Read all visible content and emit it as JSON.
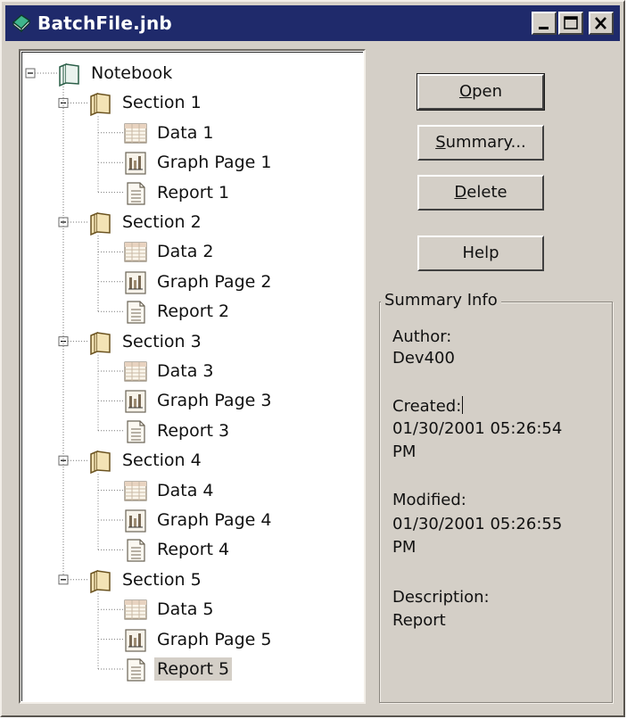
{
  "window": {
    "title": "BatchFile.jnb"
  },
  "tree": {
    "root": {
      "label": "Notebook"
    },
    "sections": [
      {
        "label": "Section 1",
        "data": "Data 1",
        "graph": "Graph Page 1",
        "report": "Report 1"
      },
      {
        "label": "Section 2",
        "data": "Data 2",
        "graph": "Graph Page 2",
        "report": "Report 2"
      },
      {
        "label": "Section 3",
        "data": "Data 3",
        "graph": "Graph Page 3",
        "report": "Report 3"
      },
      {
        "label": "Section 4",
        "data": "Data 4",
        "graph": "Graph Page 4",
        "report": "Report 4"
      },
      {
        "label": "Section 5",
        "data": "Data 5",
        "graph": "Graph Page 5",
        "report": "Report 5"
      }
    ],
    "selected": "Report 5"
  },
  "buttons": {
    "open": {
      "mn": "O",
      "rest": "pen"
    },
    "summary": {
      "mn": "S",
      "rest": "ummary..."
    },
    "delete": {
      "mn": "D",
      "rest": "elete"
    },
    "help": {
      "label": "Help"
    }
  },
  "summary": {
    "legend": "Summary Info",
    "author_label": "Author:",
    "author": "Dev400",
    "created_label": "Created:",
    "created_line1": "01/30/2001 05:26:54",
    "created_line2": "PM",
    "modified_label": "Modified:",
    "modified_line1": "01/30/2001 05:26:55",
    "modified_line2": "PM",
    "description_label": "Description:",
    "description": "Report"
  },
  "colors": {
    "titlebar": "#1f2a6b",
    "face": "#d4cfc7",
    "tree_bg": "#ffffff"
  }
}
